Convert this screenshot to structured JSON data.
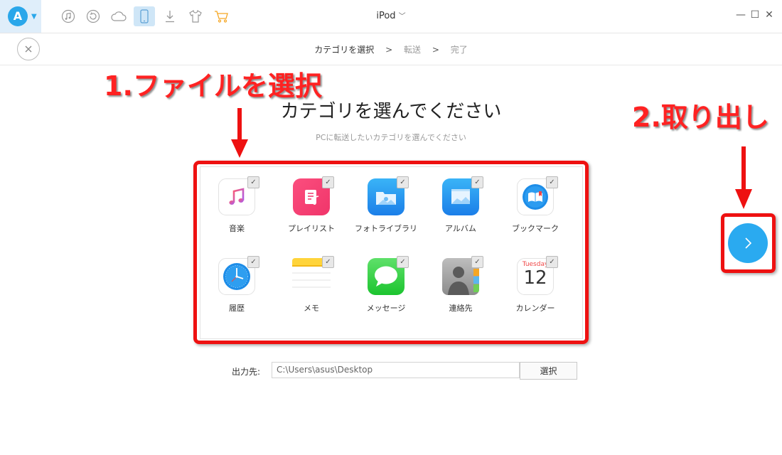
{
  "window": {
    "title": "iPod"
  },
  "toolbar": {
    "icons": [
      "music-icon",
      "history-icon",
      "cloud-icon",
      "device-icon",
      "download-icon",
      "tshirt-icon",
      "cart-icon"
    ]
  },
  "steps": {
    "current": "カテゴリを選択",
    "next": "転送",
    "last": "完了",
    "sep": ">"
  },
  "annotations": {
    "step1": "1.ファイルを選択",
    "step2": "2.取り出し"
  },
  "main": {
    "heading": "カテゴリを選んでください",
    "subheading": "PCに転送したいカテゴリを選んでください"
  },
  "categories": [
    {
      "label": "音楽",
      "checked": true
    },
    {
      "label": "プレイリスト",
      "checked": true
    },
    {
      "label": "フォトライブラリ",
      "checked": true
    },
    {
      "label": "アルバム",
      "checked": true
    },
    {
      "label": "ブックマーク",
      "checked": true
    },
    {
      "label": "履歴",
      "checked": true
    },
    {
      "label": "メモ",
      "checked": true
    },
    {
      "label": "メッセージ",
      "checked": true
    },
    {
      "label": "連絡先",
      "checked": true
    },
    {
      "label": "カレンダー",
      "checked": true
    }
  ],
  "calendar": {
    "weekday": "Tuesday",
    "day": "12"
  },
  "output": {
    "label": "出力先:",
    "path": "C:\\Users\\asus\\Desktop",
    "button": "選択"
  },
  "checkmark": "✓",
  "colors": {
    "accent": "#2aaaf0",
    "annotation": "#ee1111"
  }
}
